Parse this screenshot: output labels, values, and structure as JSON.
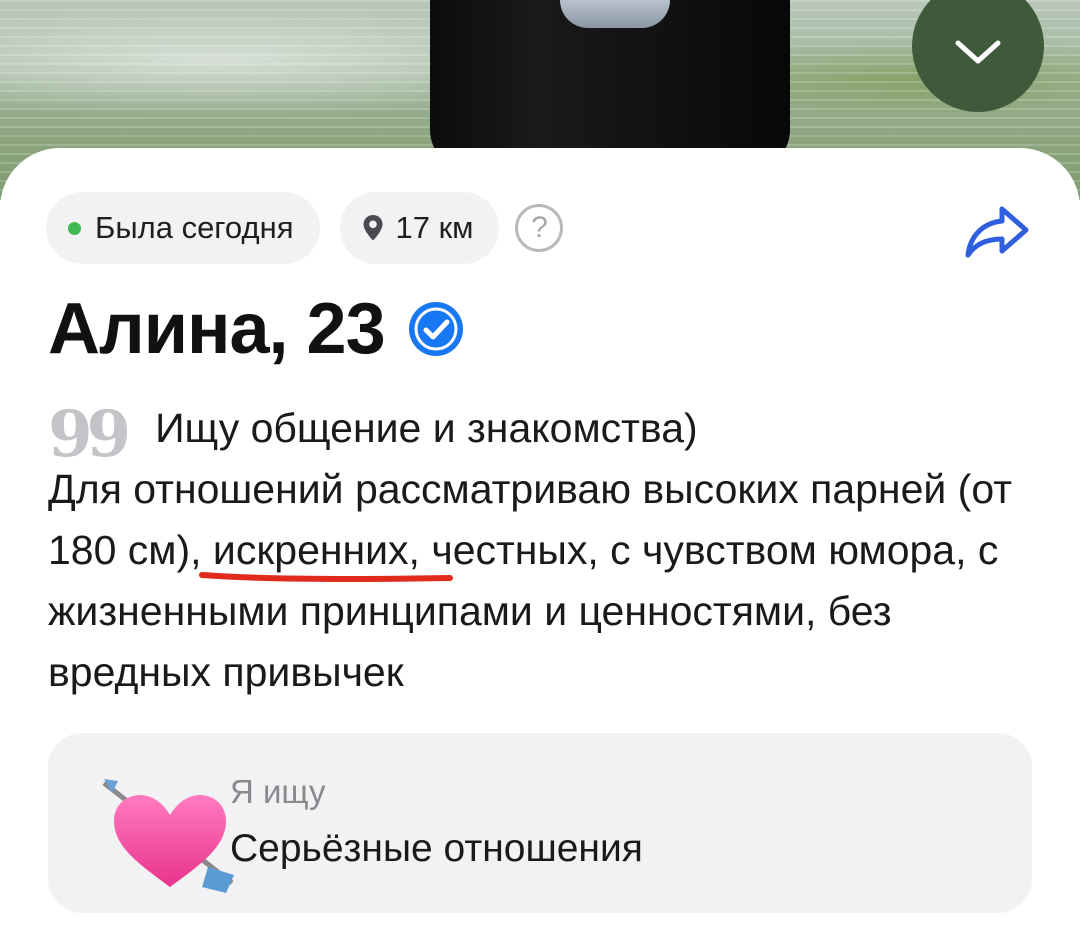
{
  "status": {
    "online_label": "Была сегодня",
    "distance_label": "17 км",
    "help_label": "?"
  },
  "profile": {
    "name_age": "Алина, 23",
    "verified": true
  },
  "bio": {
    "quote_mark": "99",
    "line1": "Ищу общение и знакомства)",
    "part_before": "Для отношений рассматриваю высоких парней ",
    "highlight": "(от 180 см)",
    "part_after": ", искренних, честных, с чувством юмора, с жизненными принципами и ценностями, без вредных привычек"
  },
  "looking_for": {
    "label": "Я ищу",
    "value": "Серьёзные отношения"
  },
  "colors": {
    "online_dot": "#3fb950",
    "verified_blue": "#1877f2",
    "underline_red": "#e02a1b",
    "share_blue": "#2f5fde",
    "collapse_button": "#3e5a3a",
    "chip_bg": "#f2f2f4"
  },
  "icons": {
    "collapse": "chevron-down-icon",
    "location": "location-pin-icon",
    "help": "question-circle-icon",
    "share": "share-arrow-icon",
    "verified": "verified-check-icon",
    "quote": "quote-icon",
    "looking_emoji": "heart-with-arrow-icon"
  }
}
